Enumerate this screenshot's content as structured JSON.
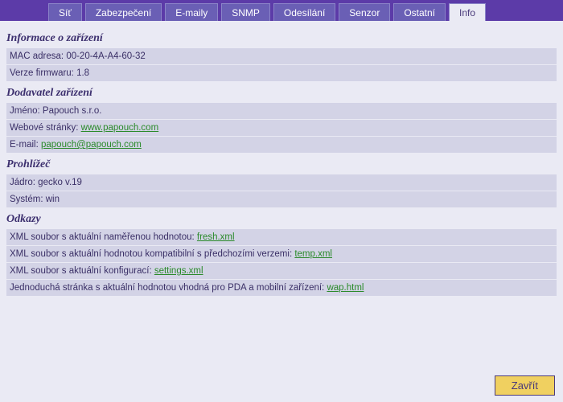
{
  "tabs": [
    {
      "label": "Síť"
    },
    {
      "label": "Zabezpečení"
    },
    {
      "label": "E-maily"
    },
    {
      "label": "SNMP"
    },
    {
      "label": "Odesílání"
    },
    {
      "label": "Senzor"
    },
    {
      "label": "Ostatní"
    },
    {
      "label": "Info"
    }
  ],
  "active_tab": "Info",
  "sections": {
    "device_info": {
      "title": "Informace o zařízení",
      "mac_label": "MAC adresa: ",
      "mac_value": "00-20-4A-A4-60-32",
      "fw_label": "Verze firmwaru: ",
      "fw_value": "1.8"
    },
    "vendor": {
      "title": "Dodavatel zařízení",
      "name_label": "Jméno: ",
      "name_value": "Papouch s.r.o.",
      "web_label": "Webové stránky: ",
      "web_link": "www.papouch.com",
      "email_label": "E-mail: ",
      "email_link": "papouch@papouch.com"
    },
    "browser": {
      "title": "Prohlížeč",
      "engine_label": "Jádro: ",
      "engine_value": "gecko v.19",
      "system_label": "Systém: ",
      "system_value": "win"
    },
    "links": {
      "title": "Odkazy",
      "xml_fresh_label": "XML soubor s aktuální naměřenou hodnotou: ",
      "xml_fresh_link": "fresh.xml",
      "xml_temp_label": "XML soubor s aktuální hodnotou kompatibilní s předchozími verzemi: ",
      "xml_temp_link": "temp.xml",
      "xml_settings_label": "XML soubor s aktuální konfigurací: ",
      "xml_settings_link": "settings.xml",
      "wap_label": "Jednoduchá stránka s aktuální hodnotou vhodná pro PDA a mobilní zařízení: ",
      "wap_link": "wap.html"
    }
  },
  "footer": {
    "close_label": "Zavřít"
  }
}
